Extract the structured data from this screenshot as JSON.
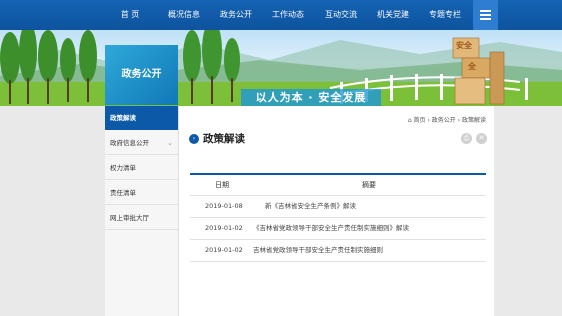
{
  "nav": {
    "items": [
      "首 页",
      "概况信息",
      "政务公开",
      "工作动态",
      "互动交流",
      "机关党建",
      "专题专栏"
    ]
  },
  "banner": {
    "section_label": "政务公开",
    "slogan": "以人为本 · 安全发展",
    "block_text": [
      "安全",
      "全"
    ]
  },
  "sidebar": {
    "items": [
      "政策解读",
      "政府信息公开",
      "权力清单",
      "责任清单",
      "网上审批大厅"
    ],
    "active_index": 0
  },
  "main": {
    "breadcrumb": "⌂ 首页 › 政务公开 › 政策解读",
    "title": "政策解读",
    "icon_print": "⎙",
    "icon_close": "✕",
    "table": {
      "headers": [
        "日期",
        "摘要"
      ],
      "rows": [
        {
          "date": "2019-01-08",
          "summary": "新《吉林省安全生产条例》解读"
        },
        {
          "date": "2019-01-02",
          "summary": "《吉林省党政领导干部安全生产责任制实施细则》解读"
        },
        {
          "date": "2019-01-02",
          "summary": "吉林省党政领导干部安全生产责任制实施细则"
        }
      ]
    }
  }
}
